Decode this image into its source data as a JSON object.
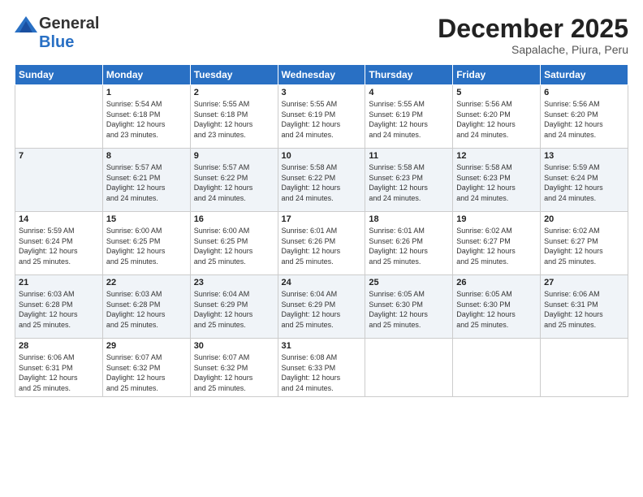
{
  "header": {
    "logo": {
      "general": "General",
      "blue": "Blue"
    },
    "title": "December 2025",
    "location": "Sapalache, Piura, Peru"
  },
  "days_of_week": [
    "Sunday",
    "Monday",
    "Tuesday",
    "Wednesday",
    "Thursday",
    "Friday",
    "Saturday"
  ],
  "weeks": [
    [
      {
        "day": "",
        "info": ""
      },
      {
        "day": "1",
        "info": "Sunrise: 5:54 AM\nSunset: 6:18 PM\nDaylight: 12 hours\nand 23 minutes."
      },
      {
        "day": "2",
        "info": "Sunrise: 5:55 AM\nSunset: 6:18 PM\nDaylight: 12 hours\nand 23 minutes."
      },
      {
        "day": "3",
        "info": "Sunrise: 5:55 AM\nSunset: 6:19 PM\nDaylight: 12 hours\nand 24 minutes."
      },
      {
        "day": "4",
        "info": "Sunrise: 5:55 AM\nSunset: 6:19 PM\nDaylight: 12 hours\nand 24 minutes."
      },
      {
        "day": "5",
        "info": "Sunrise: 5:56 AM\nSunset: 6:20 PM\nDaylight: 12 hours\nand 24 minutes."
      },
      {
        "day": "6",
        "info": "Sunrise: 5:56 AM\nSunset: 6:20 PM\nDaylight: 12 hours\nand 24 minutes."
      }
    ],
    [
      {
        "day": "7",
        "info": ""
      },
      {
        "day": "8",
        "info": "Sunrise: 5:57 AM\nSunset: 6:21 PM\nDaylight: 12 hours\nand 24 minutes."
      },
      {
        "day": "9",
        "info": "Sunrise: 5:57 AM\nSunset: 6:22 PM\nDaylight: 12 hours\nand 24 minutes."
      },
      {
        "day": "10",
        "info": "Sunrise: 5:58 AM\nSunset: 6:22 PM\nDaylight: 12 hours\nand 24 minutes."
      },
      {
        "day": "11",
        "info": "Sunrise: 5:58 AM\nSunset: 6:23 PM\nDaylight: 12 hours\nand 24 minutes."
      },
      {
        "day": "12",
        "info": "Sunrise: 5:58 AM\nSunset: 6:23 PM\nDaylight: 12 hours\nand 24 minutes."
      },
      {
        "day": "13",
        "info": "Sunrise: 5:59 AM\nSunset: 6:24 PM\nDaylight: 12 hours\nand 24 minutes."
      }
    ],
    [
      {
        "day": "14",
        "info": "Sunrise: 5:59 AM\nSunset: 6:24 PM\nDaylight: 12 hours\nand 25 minutes."
      },
      {
        "day": "15",
        "info": "Sunrise: 6:00 AM\nSunset: 6:25 PM\nDaylight: 12 hours\nand 25 minutes."
      },
      {
        "day": "16",
        "info": "Sunrise: 6:00 AM\nSunset: 6:25 PM\nDaylight: 12 hours\nand 25 minutes."
      },
      {
        "day": "17",
        "info": "Sunrise: 6:01 AM\nSunset: 6:26 PM\nDaylight: 12 hours\nand 25 minutes."
      },
      {
        "day": "18",
        "info": "Sunrise: 6:01 AM\nSunset: 6:26 PM\nDaylight: 12 hours\nand 25 minutes."
      },
      {
        "day": "19",
        "info": "Sunrise: 6:02 AM\nSunset: 6:27 PM\nDaylight: 12 hours\nand 25 minutes."
      },
      {
        "day": "20",
        "info": "Sunrise: 6:02 AM\nSunset: 6:27 PM\nDaylight: 12 hours\nand 25 minutes."
      }
    ],
    [
      {
        "day": "21",
        "info": "Sunrise: 6:03 AM\nSunset: 6:28 PM\nDaylight: 12 hours\nand 25 minutes."
      },
      {
        "day": "22",
        "info": "Sunrise: 6:03 AM\nSunset: 6:28 PM\nDaylight: 12 hours\nand 25 minutes."
      },
      {
        "day": "23",
        "info": "Sunrise: 6:04 AM\nSunset: 6:29 PM\nDaylight: 12 hours\nand 25 minutes."
      },
      {
        "day": "24",
        "info": "Sunrise: 6:04 AM\nSunset: 6:29 PM\nDaylight: 12 hours\nand 25 minutes."
      },
      {
        "day": "25",
        "info": "Sunrise: 6:05 AM\nSunset: 6:30 PM\nDaylight: 12 hours\nand 25 minutes."
      },
      {
        "day": "26",
        "info": "Sunrise: 6:05 AM\nSunset: 6:30 PM\nDaylight: 12 hours\nand 25 minutes."
      },
      {
        "day": "27",
        "info": "Sunrise: 6:06 AM\nSunset: 6:31 PM\nDaylight: 12 hours\nand 25 minutes."
      }
    ],
    [
      {
        "day": "28",
        "info": "Sunrise: 6:06 AM\nSunset: 6:31 PM\nDaylight: 12 hours\nand 25 minutes."
      },
      {
        "day": "29",
        "info": "Sunrise: 6:07 AM\nSunset: 6:32 PM\nDaylight: 12 hours\nand 25 minutes."
      },
      {
        "day": "30",
        "info": "Sunrise: 6:07 AM\nSunset: 6:32 PM\nDaylight: 12 hours\nand 25 minutes."
      },
      {
        "day": "31",
        "info": "Sunrise: 6:08 AM\nSunset: 6:33 PM\nDaylight: 12 hours\nand 24 minutes."
      },
      {
        "day": "",
        "info": ""
      },
      {
        "day": "",
        "info": ""
      },
      {
        "day": "",
        "info": ""
      }
    ]
  ]
}
